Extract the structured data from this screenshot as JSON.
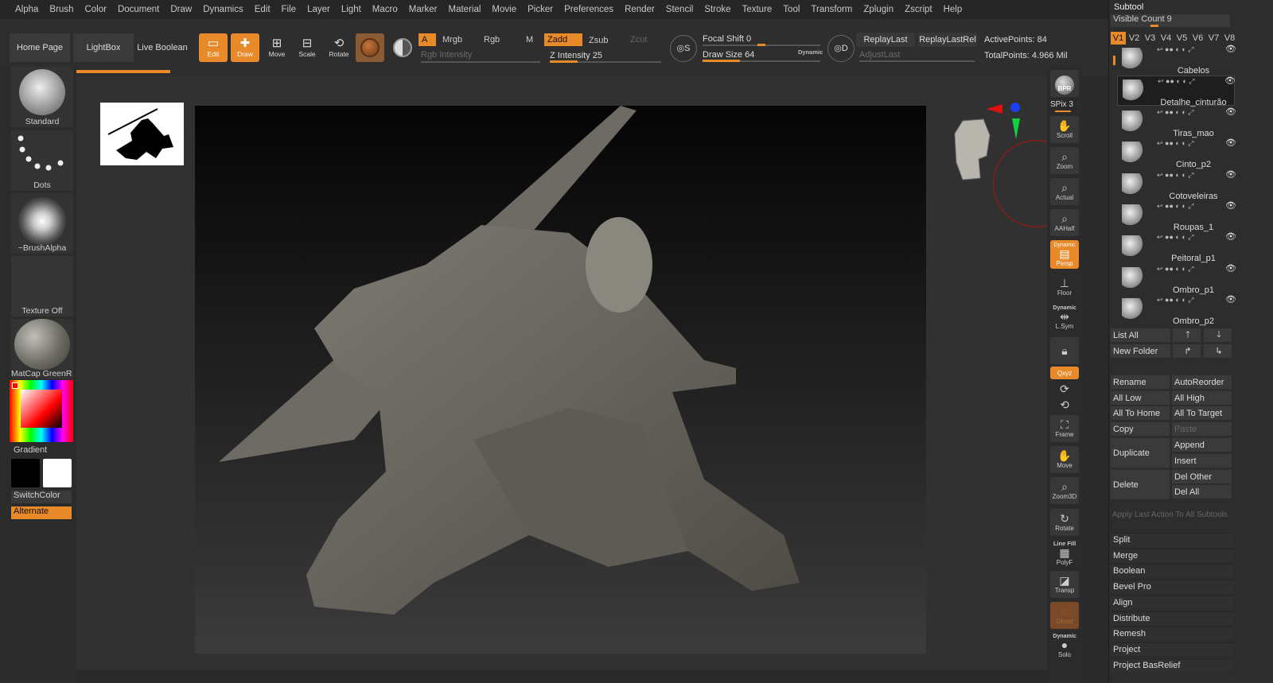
{
  "menu": [
    "Alpha",
    "Brush",
    "Color",
    "Document",
    "Draw",
    "Dynamics",
    "Edit",
    "File",
    "Layer",
    "Light",
    "Macro",
    "Marker",
    "Material",
    "Movie",
    "Picker",
    "Preferences",
    "Render",
    "Stencil",
    "Stroke",
    "Texture",
    "Tool",
    "Transform",
    "Zplugin",
    "Zscript",
    "Help"
  ],
  "toolbar": {
    "home_page": "Home Page",
    "lightbox": "LightBox",
    "live_boolean": "Live Boolean",
    "edit": "Edit",
    "draw": "Draw",
    "move": "Move",
    "scale": "Scale",
    "rotate": "Rotate",
    "a": "A",
    "mrgb": "Mrgb",
    "rgb": "Rgb",
    "m": "M",
    "zadd": "Zadd",
    "zsub": "Zsub",
    "zcut": "Zcut",
    "rgb_intensity": "Rgb Intensity",
    "z_intensity": "Z Intensity 25",
    "focal_shift": "Focal Shift 0",
    "draw_size": "Draw Size 64",
    "dynamic": "Dynamic",
    "replay_last": "ReplayLast",
    "replay_last_rel": "ReplayLastRel",
    "adjust_last": "AdjustLast",
    "active_points": "ActivePoints: 84",
    "total_points": "TotalPoints: 4.966 Mil",
    "z_intensity_value": 25,
    "focal_shift_value": 0,
    "draw_size_value": 64
  },
  "left": {
    "brush": "Standard",
    "stroke": "Dots",
    "alpha": "~BrushAlpha",
    "texture": "Texture Off",
    "material": "MatCap GreenR",
    "gradient": "Gradient",
    "switch_color": "SwitchColor",
    "alternate": "Alternate"
  },
  "right": {
    "bpr": "BPR",
    "spix": "SPix 3",
    "scroll": "Scroll",
    "zoom": "Zoom",
    "actual": "Actual",
    "aahalf": "AAHalf",
    "dynamic": "Dynamic",
    "persp": "Persp",
    "floor": "Floor",
    "dynamic2": "Dynamic",
    "lsym": "L.Sym",
    "xyz": "Qxyz",
    "frame": "Frame",
    "move": "Move",
    "zoom3d": "Zoom3D",
    "rotate": "Rotate",
    "line_fill": "Line Fill",
    "polyf": "PolyF",
    "transp": "Transp",
    "ghost": "Ghost",
    "dynamic3": "Dynamic",
    "solo": "Solo"
  },
  "subtool": {
    "title": "Subtool",
    "visible_count": "Visible Count 9",
    "versions": [
      "V1",
      "V2",
      "V3",
      "V4",
      "V5",
      "V6",
      "V7",
      "V8"
    ],
    "items": [
      "Cabelos",
      "Detalhe_cinturão",
      "Tiras_mao",
      "Cinto_p2",
      "Cotoveleiras",
      "Roupas_1",
      "Peitoral_p1",
      "Ombro_p1",
      "Ombro_p2"
    ],
    "list_all": "List All",
    "new_folder": "New Folder",
    "rename": "Rename",
    "auto_reorder": "AutoReorder",
    "all_low": "All Low",
    "all_high": "All High",
    "all_to_home": "All To Home",
    "all_to_target": "All To Target",
    "copy": "Copy",
    "paste": "Paste",
    "duplicate": "Duplicate",
    "append": "Append",
    "insert": "Insert",
    "delete": "Delete",
    "del_other": "Del Other",
    "del_all": "Del All",
    "apply_last": "Apply Last Action To All Subtools",
    "sections": [
      "Split",
      "Merge",
      "Boolean",
      "Bevel Pro",
      "Align",
      "Distribute",
      "Remesh",
      "Project",
      "Project BasRelief"
    ]
  }
}
